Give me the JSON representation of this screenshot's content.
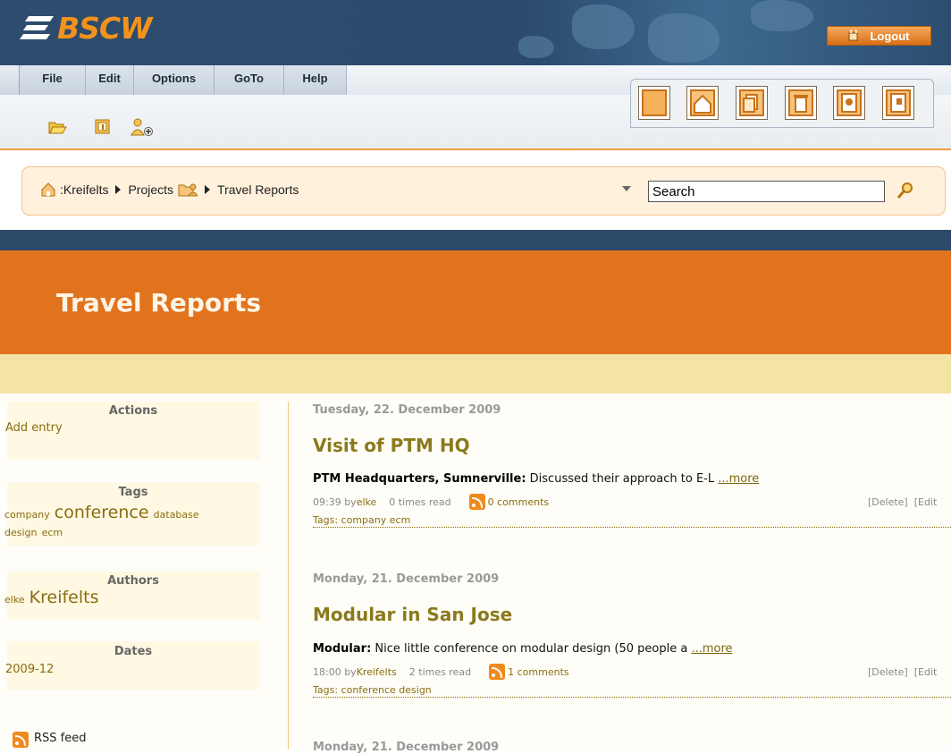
{
  "header": {
    "logo_text": "BSCW",
    "logout_label": "Logout"
  },
  "menu": [
    {
      "label": "File"
    },
    {
      "label": "Edit"
    },
    {
      "label": "Options"
    },
    {
      "label": "GoTo"
    },
    {
      "label": "Help"
    }
  ],
  "toolbar_icons": [
    "open-folder-icon",
    "info-icon",
    "add-member-icon"
  ],
  "view_tabs": [
    "clipboard-icon",
    "home-icon",
    "documents-icon",
    "trash-icon",
    "addressbook-icon",
    "calendar-icon"
  ],
  "breadcrumb": {
    "home": ":Kreifelts",
    "parent": "Projects",
    "current": "Travel Reports"
  },
  "search": {
    "value": "Search"
  },
  "page": {
    "title": "Travel Reports"
  },
  "sidebar": {
    "actions": {
      "heading": "Actions",
      "add_entry": "Add entry"
    },
    "tags": {
      "heading": "Tags",
      "items": [
        "company",
        "conference",
        "database",
        "design",
        "ecm"
      ]
    },
    "authors": {
      "heading": "Authors",
      "items": [
        "elke",
        "Kreifelts"
      ]
    },
    "dates": {
      "heading": "Dates",
      "items": [
        "2009-12"
      ]
    },
    "rss_label": "RSS feed"
  },
  "entries": [
    {
      "date": "Tuesday, 22. December 2009",
      "title": "Visit of PTM HQ",
      "lead": "PTM Headquarters, Sumnerville:",
      "summary": " Discussed their approach to E-L ",
      "more": "...more",
      "time": "09:39 by ",
      "author": "elke",
      "reads": "0 times read",
      "comments": "0 comments",
      "delete": "[Delete]",
      "edit": "[Edit",
      "tags_label": "Tags: company ecm"
    },
    {
      "date": "Monday, 21. December 2009",
      "title": "Modular in San Jose",
      "lead": "Modular:",
      "summary": " Nice little conference on modular design (50 people a ",
      "more": "...more",
      "time": "18:00 by ",
      "author": "Kreifelts",
      "reads": "2 times read",
      "comments": "1 comments",
      "delete": "[Delete]",
      "edit": "[Edit",
      "tags_label": "Tags: conference design"
    },
    {
      "date": "Monday, 21. December 2009"
    }
  ],
  "colors": {
    "navy": "#2d4a6a",
    "orange": "#e2731e",
    "accent_text": "#8a7a1c",
    "cream": "#f3e4a6"
  }
}
